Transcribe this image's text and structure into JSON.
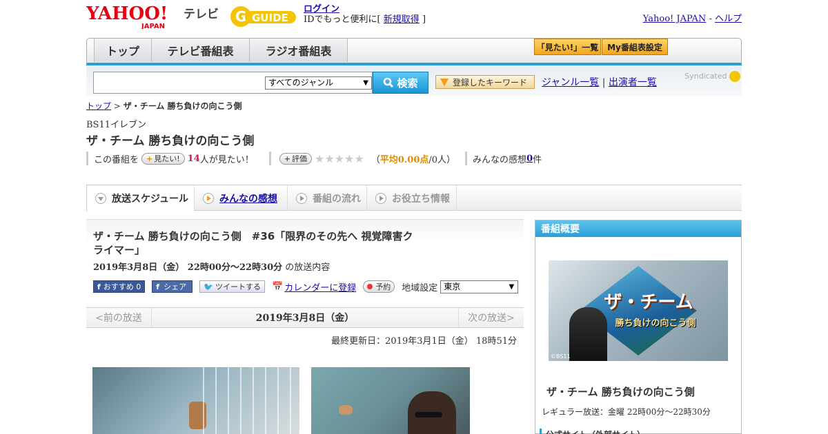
{
  "header": {
    "yahoo_logo_text": "YAHOO!",
    "yahoo_logo_sub": "JAPAN",
    "tv_label": "テレビ",
    "gguide_logo_text": "GUIDE",
    "login_label": "ログイン",
    "login_prompt_prefix": "IDでもっと便利に[",
    "register_label": "新規取得",
    "login_prompt_suffix": "]",
    "yahoo_japan_link": "Yahoo! JAPAN",
    "separator": " - ",
    "help_link": "ヘルプ"
  },
  "nav": {
    "tabs": [
      {
        "label": "トップ"
      },
      {
        "label": "テレビ番組表"
      },
      {
        "label": "ラジオ番組表"
      }
    ],
    "watchlist_button": "「見たい!」一覧",
    "my_schedule_button": "My番組表設定"
  },
  "search": {
    "input_value": "",
    "genre_selected": "すべてのジャンル",
    "search_button": "検索",
    "keyword_button": "登録したキーワード",
    "genre_list_link": "ジャンル一覧",
    "divider": "|",
    "performer_list_link": "出演者一覧",
    "syndicated_label": "Syndicated"
  },
  "breadcrumb": {
    "top": "トップ",
    "sep": " > ",
    "current": "ザ・チーム 勝ち負けの向こう側"
  },
  "program": {
    "channel": "BS11イレブン",
    "title": "ザ・チーム 勝ち負けの向こう側",
    "want_prefix": "この番組を",
    "want_button": "見たい!",
    "want_count": "14",
    "want_suffix": "人が見たい！",
    "rate_button": "評価",
    "stars": "★★★★★",
    "avg_prefix": "（",
    "avg_label": "平均0.00点",
    "avg_suffix": "/0人）",
    "comments_prefix": "みんなの感想 ",
    "comments_count": "0",
    "comments_suffix": "件"
  },
  "subtabs": [
    {
      "label": "放送スケジュール"
    },
    {
      "label": "みんなの感想"
    },
    {
      "label": "番組の流れ"
    },
    {
      "label": "お役立ち情報"
    }
  ],
  "episode": {
    "title": "ザ・チーム 勝ち負けの向こう側　#36「限界のその先へ 視覚障害クライマー」",
    "datetime": "2019年3月8日（金）  22時00分～22時30分",
    "datetime_suffix": " の放送内容",
    "fb_recommend": "おすすめ 0",
    "fb_share": "シェア",
    "tweet": "ツイートする",
    "calendar": "カレンダーに登録",
    "reserve": "予約",
    "region_label": "地域設定",
    "region_selected": "東京"
  },
  "date_nav": {
    "prev": "<前の放送",
    "current": "2019年3月8日（金）",
    "next": "次の放送>"
  },
  "updated": "最終更新日：2019年3月1日（金） 18時51分",
  "overview": {
    "header": "番組概要",
    "image_title": "ザ・チーム",
    "image_subtitle": "勝ち負けの向こう側",
    "image_copyright": "©BS11",
    "title": "ザ・チーム 勝ち負けの向こう側",
    "regular": "レギュラー放送：金曜 22時00分～22時30分",
    "official_site": "公式サイト（外部サイト）"
  },
  "colors": {
    "accent_blue": "#2a9ed6",
    "link": "#1a0dab",
    "orange": "#f0a51f",
    "pink_count": "#d4145a"
  }
}
